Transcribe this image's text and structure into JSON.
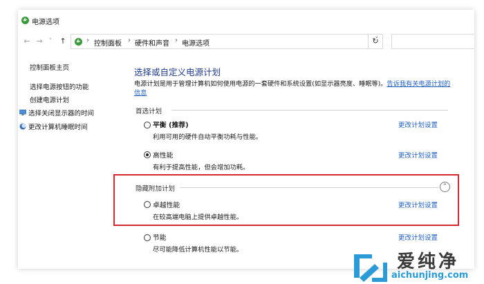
{
  "window": {
    "title": "电源选项"
  },
  "navbar": {
    "back": "←",
    "forward": "→",
    "dropdown": "˅",
    "up": "↑",
    "breadcrumbs": [
      "控制面板",
      "硬件和声音",
      "电源选项"
    ],
    "separator": "›",
    "addr_dropdown": "˅",
    "refresh": "↻"
  },
  "sidebar": {
    "home": "控制面板主页",
    "items": [
      {
        "label": "选择电源按钮的功能",
        "icon": "none"
      },
      {
        "label": "创建电源计划",
        "icon": "none"
      },
      {
        "label": "选择关闭显示器的时间",
        "icon": "monitor-icon"
      },
      {
        "label": "更改计算机睡眠时间",
        "icon": "moon-icon"
      }
    ]
  },
  "main": {
    "title": "选择或自定义电源计划",
    "description": "电源计划是用于管理计算机如何使用电源的一套硬件和系统设置(如显示器亮度、睡眠等)。",
    "description_link": "告诉我有关电源计划的信息",
    "preferred_label": "首选计划",
    "hidden_label": "隐藏附加计划",
    "collapse_glyph": "⌃",
    "change_label": "更改计划设置",
    "plans": [
      {
        "name": "平衡 (推荐)",
        "desc": "利用可用的硬件自动平衡功耗与性能。",
        "selected": false
      },
      {
        "name": "高性能",
        "desc": "有利于提高性能，但会增加功耗。",
        "selected": true
      },
      {
        "name": "卓越性能",
        "desc": "在较高端电脑上提供卓越性能。",
        "selected": false
      },
      {
        "name": "节能",
        "desc": "尽可能降低计算机性能以节能。",
        "selected": false
      }
    ]
  },
  "watermark": {
    "text": "爱纯净",
    "url": "aichunjing.com"
  },
  "colors": {
    "link": "#1e5fbf",
    "title": "#1e3a8a",
    "highlight": "#d6262e"
  }
}
